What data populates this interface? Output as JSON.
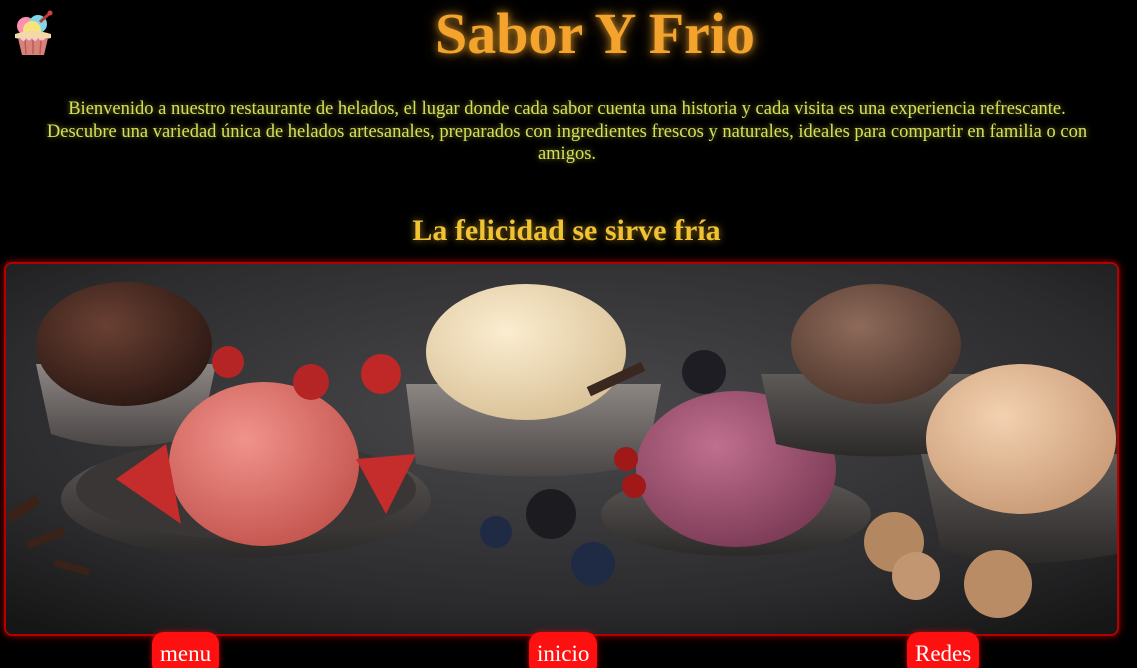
{
  "header": {
    "logo_icon": "ice-cream-cup-icon",
    "title": "Sabor Y Frio"
  },
  "intro": {
    "text": "Bienvenido a nuestro restaurante de helados, el lugar donde cada sabor cuenta una historia y cada visita es una experiencia refrescante. Descubre una variedad única de helados artesanales, preparados con ingredientes frescos y naturales, ideales para compartir en familia o con amigos."
  },
  "tagline": "La felicidad se sirve fría",
  "hero": {
    "image_subject": "ice-cream-bowls-photo"
  },
  "nav": {
    "menu_label": "menu",
    "inicio_label": "inicio",
    "redes_label": "Redes"
  },
  "colors": {
    "background": "#000000",
    "title": "#f4a42c",
    "intro_text": "#cfe35a",
    "tagline": "#f1c232",
    "button_bg": "#ff1010",
    "frame_border": "#b30000"
  }
}
